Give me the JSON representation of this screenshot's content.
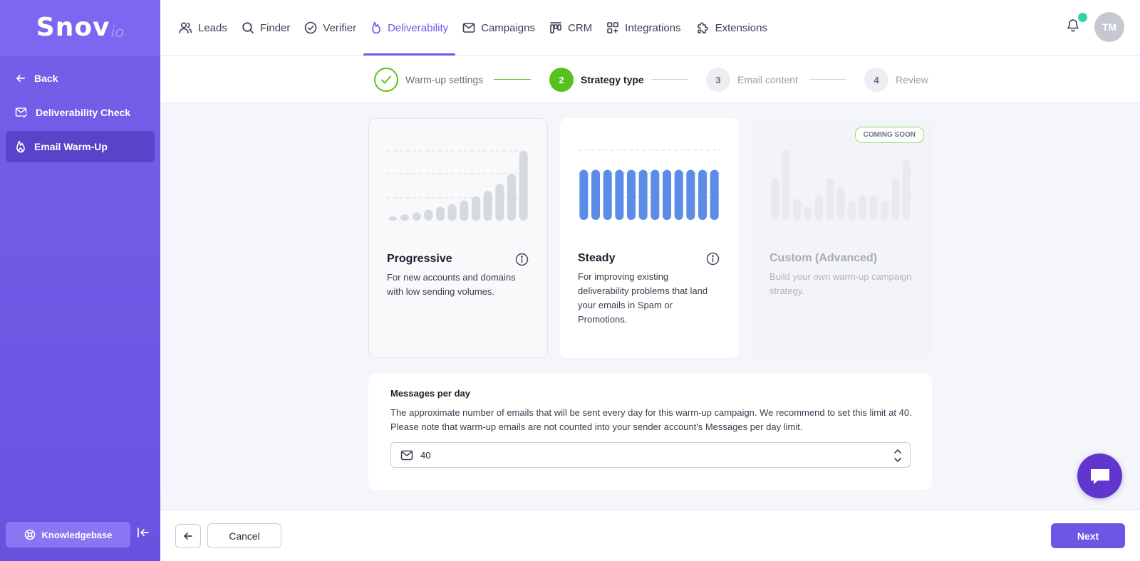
{
  "brand": {
    "logo_main": "Snov",
    "logo_suffix": "io"
  },
  "sidebar": {
    "items": [
      {
        "label": "Back",
        "icon": "arrow-left-icon"
      },
      {
        "label": "Deliverability Check",
        "icon": "mail-check-icon"
      },
      {
        "label": "Email Warm-Up",
        "icon": "flame-icon",
        "active": true
      }
    ],
    "knowledgebase_label": "Knowledgebase"
  },
  "topnav": {
    "items": [
      {
        "label": "Leads",
        "icon": "users-icon"
      },
      {
        "label": "Finder",
        "icon": "search-icon"
      },
      {
        "label": "Verifier",
        "icon": "check-circle-icon"
      },
      {
        "label": "Deliverability",
        "icon": "flame-icon",
        "active": true
      },
      {
        "label": "Campaigns",
        "icon": "mail-icon"
      },
      {
        "label": "CRM",
        "icon": "kanban-icon"
      },
      {
        "label": "Integrations",
        "icon": "grid-icon"
      },
      {
        "label": "Extensions",
        "icon": "puzzle-icon"
      }
    ],
    "avatar_initials": "TM"
  },
  "stepper": {
    "steps": [
      {
        "number": "1",
        "label": "Warm-up settings",
        "state": "done"
      },
      {
        "number": "2",
        "label": "Strategy type",
        "state": "active"
      },
      {
        "number": "3",
        "label": "Email content",
        "state": "todo"
      },
      {
        "number": "4",
        "label": "Review",
        "state": "todo"
      }
    ]
  },
  "strategies": [
    {
      "title": "Progressive",
      "description": "For new accounts and domains with low sending volumes.",
      "bars": [
        6,
        9,
        12,
        16,
        20,
        24,
        29,
        35,
        43,
        53,
        67,
        100
      ],
      "bar_color": "#d7d9e0"
    },
    {
      "title": "Steady",
      "description": "For improving existing deliverability problems that land your emails in Spam or Promotions.",
      "bars": [
        72,
        72,
        72,
        72,
        72,
        72,
        72,
        72,
        72,
        72,
        72,
        72
      ],
      "bar_color": "#5b8de8",
      "selected": true
    },
    {
      "title": "Custom (Advanced)",
      "description": "Build your own warm-up campaign strategy.",
      "badge": "COMING SOON",
      "bars": [
        60,
        100,
        30,
        19,
        36,
        60,
        47,
        28,
        36,
        36,
        28,
        60,
        86
      ],
      "bar_color": "#e9eaef",
      "disabled": true
    }
  ],
  "messages": {
    "label": "Messages per day",
    "description": "The approximate number of emails that will be sent every day for this warm-up campaign. We recommend to set this limit at 40. Please note that warm-up emails are not counted into your sender account's Messages per day limit.",
    "value": "40"
  },
  "footer": {
    "cancel_label": "Cancel",
    "next_label": "Next"
  },
  "colors": {
    "accent": "#6f55e6",
    "success": "#55c01f",
    "sidebar": "#6a52e0"
  }
}
